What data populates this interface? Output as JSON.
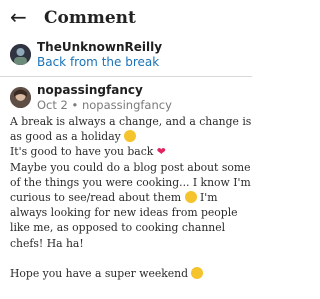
{
  "header": {
    "back_icon": "arrow-left-icon",
    "title": "Comment"
  },
  "post": {
    "author": "TheUnknownReilly",
    "link_text": "Back from the break"
  },
  "comment": {
    "author": "nopassingfancy",
    "meta": "Oct 2 • nopassingfancy",
    "body_1": "A break is always a change, and a change is as good as a holiday",
    "body_2": "It's good to have you back",
    "body_3": "Maybe you could do a blog post about some of the things you were cooking... I know I'm curious to see/read about them",
    "body_4": "I'm always looking for new ideas from people like me, as opposed to cooking channel chefs! Ha ha!",
    "closing": "Hope you have a super weekend"
  },
  "colors": {
    "link": "#1a73b8",
    "heart": "#e0245e",
    "emoji": "#f5c32c"
  }
}
